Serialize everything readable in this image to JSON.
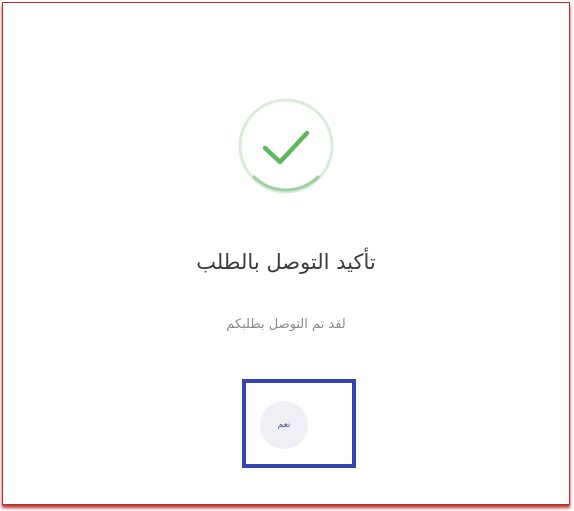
{
  "dialog": {
    "title": "تأكيد التوصل بالطلب",
    "message": "لقد تم التوصل بطلبكم",
    "confirm_label": "نعم",
    "icon": "check-circle-icon",
    "colors": {
      "success": "#5cb85c",
      "success_ring": "#d8ecd8",
      "border": "#c8282a",
      "highlight": "#3744b4",
      "button_bg": "#eef0f6",
      "button_text": "#4654a8"
    }
  }
}
